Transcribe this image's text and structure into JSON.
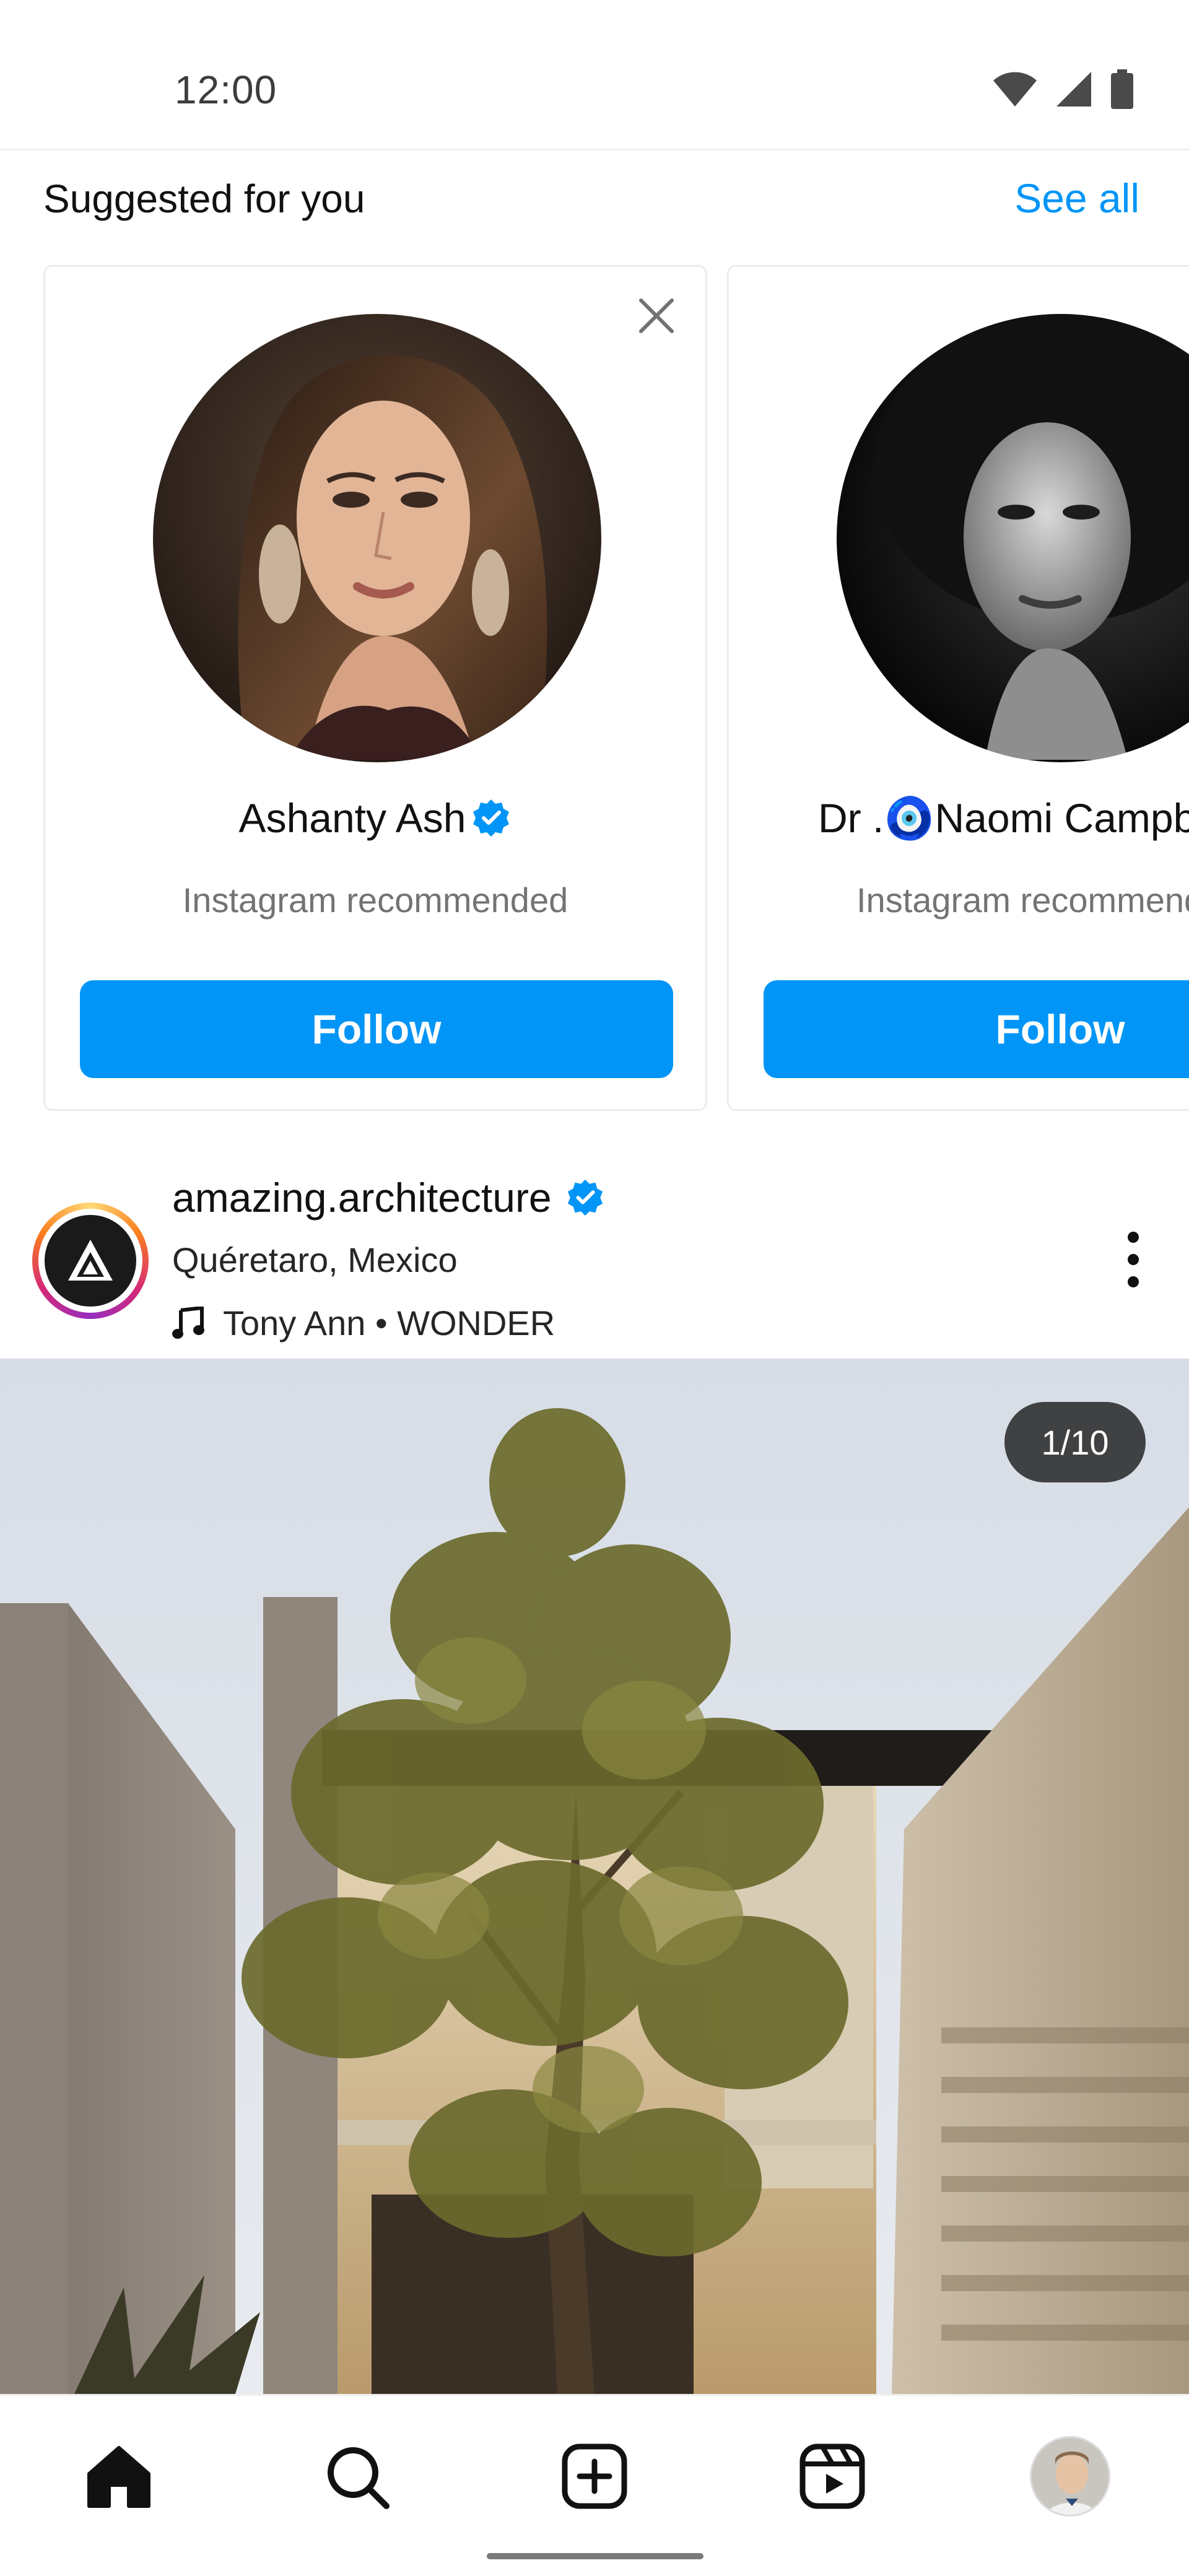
{
  "status_bar": {
    "time": "12:00",
    "icons": [
      "wifi-icon",
      "cellular-signal-icon",
      "battery-icon"
    ]
  },
  "suggested": {
    "title": "Suggested for you",
    "see_all_label": "See all",
    "cards": [
      {
        "name": "Ashanty Ash",
        "verified": true,
        "subtitle": "Instagram recommended",
        "follow_label": "Follow"
      },
      {
        "name": "Dr .🧿Naomi Campbell",
        "verified": false,
        "subtitle": "Instagram recommended",
        "follow_label": "Follow"
      }
    ]
  },
  "post": {
    "username": "amazing.architecture",
    "verified": true,
    "location": "Quéretaro, Mexico",
    "music": "Tony Ann • WONDER",
    "counter": "1/10"
  },
  "bottom_nav": {
    "items": [
      "home-icon",
      "search-icon",
      "create-icon",
      "reels-icon",
      "profile-avatar"
    ]
  },
  "colors": {
    "accent_blue": "#0095f6",
    "verified_blue": "#0095f6",
    "text_primary": "#111111",
    "text_secondary": "#737373"
  }
}
